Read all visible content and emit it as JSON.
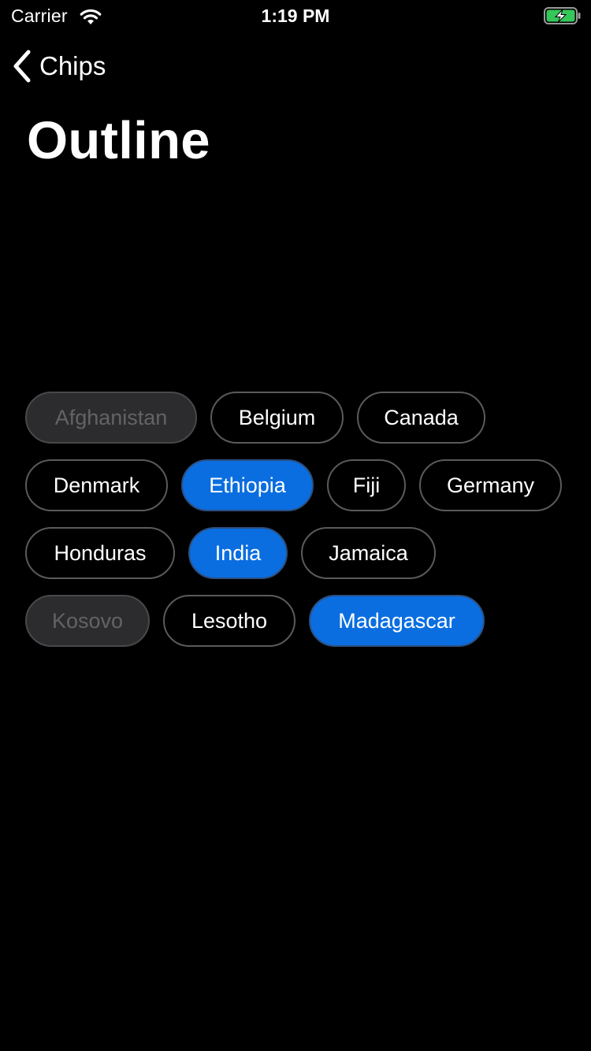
{
  "status_bar": {
    "carrier": "Carrier",
    "time": "1:19 PM",
    "battery_color": "#34c759"
  },
  "nav": {
    "back_label": "Chips"
  },
  "page": {
    "title": "Outline"
  },
  "colors": {
    "background": "#000000",
    "selected_chip": "#0a6ee0",
    "disabled_chip": "#2c2c2e"
  },
  "chips": [
    {
      "label": "Afghanistan",
      "state": "disabled"
    },
    {
      "label": "Belgium",
      "state": "normal"
    },
    {
      "label": "Canada",
      "state": "normal"
    },
    {
      "label": "Denmark",
      "state": "normal"
    },
    {
      "label": "Ethiopia",
      "state": "selected"
    },
    {
      "label": "Fiji",
      "state": "normal"
    },
    {
      "label": "Germany",
      "state": "normal"
    },
    {
      "label": "Honduras",
      "state": "normal"
    },
    {
      "label": "India",
      "state": "selected"
    },
    {
      "label": "Jamaica",
      "state": "normal"
    },
    {
      "label": "Kosovo",
      "state": "disabled"
    },
    {
      "label": "Lesotho",
      "state": "normal"
    },
    {
      "label": "Madagascar",
      "state": "selected"
    }
  ]
}
